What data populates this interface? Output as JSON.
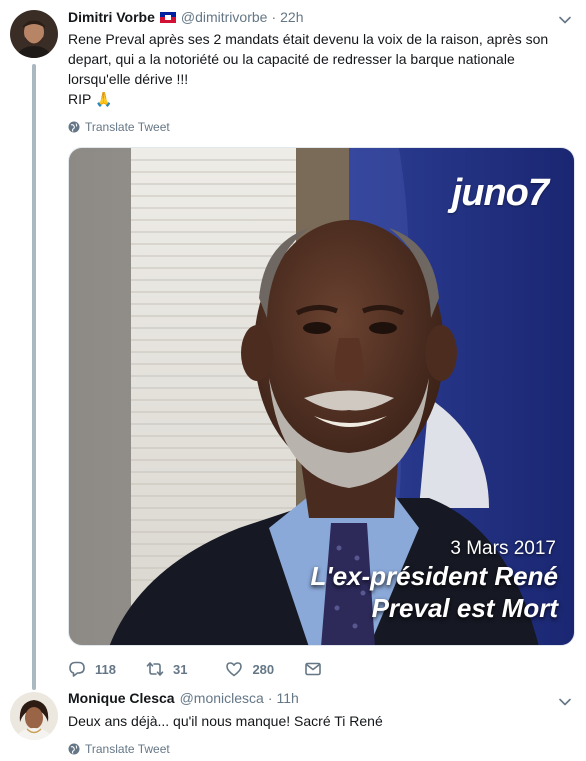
{
  "tweet1": {
    "author_name": "Dimitri Vorbe",
    "author_flag": "haiti-flag",
    "author_handle": "@dimitrivorbe",
    "separator": "·",
    "time": "22h",
    "text_lines": [
      "Rene Preval après ses 2 mandats était devenu la voix de la raison, après son",
      "depart, qui a la notoriété ou la capacité de redresser la barque nationale",
      "lorsqu'elle dérive !!!",
      "RIP 🙏"
    ],
    "translate_label": "Translate Tweet",
    "media": {
      "logo_text": "juno7",
      "date": "3 Mars 2017",
      "headline_line1": "L'ex-président René",
      "headline_line2": "Preval est Mort"
    },
    "actions": {
      "replies": "118",
      "retweets": "31",
      "likes": "280"
    }
  },
  "tweet2": {
    "author_name": "Monique Clesca",
    "author_handle": "@moniclesca",
    "separator": "·",
    "time": "11h",
    "text": "Deux ans déjà... qu'il nous manque! Sacré Ti René",
    "translate_label": "Translate Tweet"
  },
  "colors": {
    "text": "#14171a",
    "secondary": "#657786",
    "thread_line": "#aab8c2",
    "border": "#e1e8ed"
  }
}
